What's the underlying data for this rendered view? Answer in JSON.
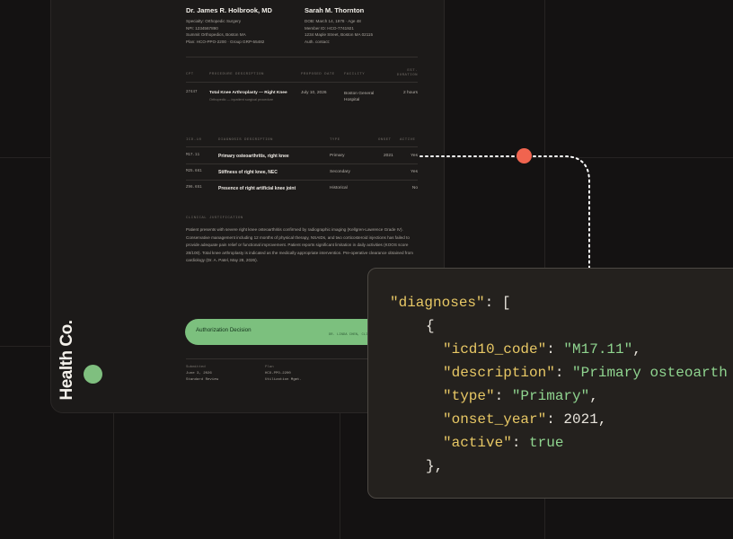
{
  "provider": {
    "name": "Dr. James R. Holbrook, MD",
    "lines": [
      "Specialty: Orthopedic Surgery",
      "NPI: 1234567890",
      "Summit Orthopedics, Boston MA",
      "Plan: HCO-PPO-2200 · Group GRP-55482"
    ]
  },
  "patient": {
    "name": "Sarah M. Thornton",
    "lines": [
      "DOB: March 14, 1978 · Age 48",
      "Member ID: HCO-7741921",
      "1234 Maple Street, Boston MA 02115",
      "Auth. contact:"
    ]
  },
  "procedures": {
    "headers": [
      "CPT",
      "Procedure Description",
      "Proposed Date",
      "Facility",
      "Est. Duration"
    ],
    "rows": [
      {
        "cpt": "27447",
        "description": "Total Knee Arthroplasty — Right Knee",
        "sub": "Orthopedic — inpatient surgical procedure",
        "date": "July 10, 2026",
        "facility": "Boston General Hospital",
        "duration": "2 hours"
      }
    ]
  },
  "diagnoses_table": {
    "headers": [
      "ICD-10",
      "Diagnosis Description",
      "Type",
      "Onset",
      "Active"
    ],
    "rows": [
      {
        "code": "M17.11",
        "description": "Primary osteoarthritis, right knee",
        "type": "Primary",
        "onset": "2021",
        "active": "Yes"
      },
      {
        "code": "M25.661",
        "description": "Stiffness of right knee, NEC",
        "type": "Secondary",
        "onset": "",
        "active": "Yes"
      },
      {
        "code": "Z96.651",
        "description": "Presence of right artificial knee joint",
        "type": "Historical",
        "onset": "",
        "active": "No"
      }
    ]
  },
  "justification": {
    "heading": "Clinical Justification",
    "text": "Patient presents with severe right knee osteoarthritis confirmed by radiographic imaging (Kellgren-Lawrence Grade IV). Conservative management including 12 months of physical therapy, NSAIDs, and two corticosteroid injections has failed to provide adequate pain relief or functional improvement. Patient reports significant limitation in daily activities (KOOS score 28/100). Total knee arthroplasty is indicated as the medically appropriate intervention. Pre-operative clearance obtained from cardiology (Dr. A. Patel, May 28, 2026)."
  },
  "authorization": {
    "label": "Authorization Decision",
    "signature": "DR. LINDA CHEN, CLIN"
  },
  "footer": {
    "submitted_label": "Submitted",
    "submitted_values": [
      "June 3, 2026",
      "Standard Review"
    ],
    "plan_label": "Plan",
    "plan_values": [
      "HCO-PPO-2200",
      "Utilization Mgmt."
    ]
  },
  "brand": {
    "name": "Health Co."
  },
  "code": {
    "lines": [
      {
        "key": "\"diagnoses\"",
        "punct": ": [",
        "value": "",
        "tail": ""
      },
      {
        "key": "",
        "punct": "{",
        "value": "",
        "tail": ""
      },
      {
        "key": "\"icd10_code\"",
        "punct": ": ",
        "value": "\"M17.11\"",
        "tail": ","
      },
      {
        "key": "\"description\"",
        "punct": ": ",
        "value": "\"Primary osteoarth",
        "tail": ""
      },
      {
        "key": "\"type\"",
        "punct": ": ",
        "value": "\"Primary\"",
        "tail": ","
      },
      {
        "key": "\"onset_year\"",
        "punct": ": ",
        "value": "2021",
        "tail": ","
      },
      {
        "key": "\"active\"",
        "punct": ": ",
        "value": "true",
        "tail": ""
      },
      {
        "key": "",
        "punct": "},",
        "value": "",
        "tail": ""
      }
    ]
  },
  "colors": {
    "background": "#141212",
    "document": "#1c1a19",
    "accent_green": "#7cc07e",
    "connector_dot": "#f0644f",
    "code_key": "#e8c865",
    "code_string": "#8fd48f"
  }
}
